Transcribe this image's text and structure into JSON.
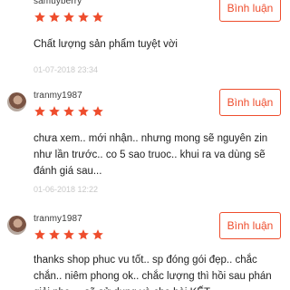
{
  "accent_color": "#ee4d2d",
  "reviews": [
    {
      "username": "samuyberry",
      "rating": 5,
      "reply_label": "Bình luận",
      "comment": "Chất lượng sản phẩm tuyệt vời",
      "date": "01-07-2018 23:34"
    },
    {
      "username": "tranmy1987",
      "rating": 5,
      "reply_label": "Bình luận",
      "comment": "chưa xem.. mới nhận.. nhưng mong sẽ nguyên zin như lần trước.. co 5 sao truoc.. khui ra va dùng sẽ đánh giá sau...",
      "date": "01-06-2018 12:22"
    },
    {
      "username": "tranmy1987",
      "rating": 5,
      "reply_label": "Bình luận",
      "comment": "thanks shop phuc vu tốt.. sp đóng gói đẹp.. chắc chắn.. niêm phong ok.. chắc lượng thì hồi sau phán giải nhe.... sẽ sử dụng và cho bài KẾT"
    }
  ]
}
